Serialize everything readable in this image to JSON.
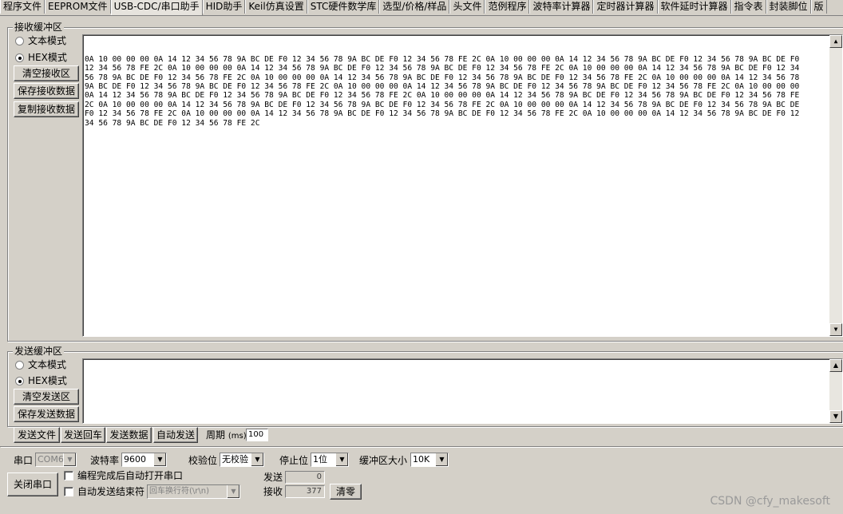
{
  "tabs": [
    "程序文件",
    "EEPROM文件",
    "USB-CDC/串口助手",
    "HID助手",
    "Keil仿真设置",
    "STC硬件数学库",
    "选型/价格/样品",
    "头文件",
    "范例程序",
    "波特率计算器",
    "定时器计算器",
    "软件延时计算器",
    "指令表",
    "封装脚位",
    "版"
  ],
  "receive": {
    "title": "接收缓冲区",
    "mode_text": "文本模式",
    "mode_hex": "HEX模式",
    "clear_btn": "清空接收区",
    "save_btn": "保存接收数据",
    "copy_btn": "复制接收数据",
    "lines": [
      "0A 10 00 00 00 0A 14 12 34 56 78 9A BC DE F0 12 34 56 78 9A BC DE F0 12 34 56 78 FE 2C 0A 10 00 00 00 0A 14 12 34 56 78 9A BC DE F0 12 34 56 78 9A BC DE F0",
      "12 34 56 78 FE 2C 0A 10 00 00 00 0A 14 12 34 56 78 9A BC DE F0 12 34 56 78 9A BC DE F0 12 34 56 78 FE 2C 0A 10 00 00 00 0A 14 12 34 56 78 9A BC DE F0 12 34",
      "56 78 9A BC DE F0 12 34 56 78 FE 2C 0A 10 00 00 00 0A 14 12 34 56 78 9A BC DE F0 12 34 56 78 9A BC DE F0 12 34 56 78 FE 2C 0A 10 00 00 00 0A 14 12 34 56 78",
      "9A BC DE F0 12 34 56 78 9A BC DE F0 12 34 56 78 FE 2C 0A 10 00 00 00 0A 14 12 34 56 78 9A BC DE F0 12 34 56 78 9A BC DE F0 12 34 56 78 FE 2C 0A 10 00 00 00",
      "0A 14 12 34 56 78 9A BC DE F0 12 34 56 78 9A BC DE F0 12 34 56 78 FE 2C 0A 10 00 00 00 0A 14 12 34 56 78 9A BC DE F0 12 34 56 78 9A BC DE F0 12 34 56 78 FE",
      "2C 0A 10 00 00 00 0A 14 12 34 56 78 9A BC DE F0 12 34 56 78 9A BC DE F0 12 34 56 78 FE 2C 0A 10 00 00 00 0A 14 12 34 56 78 9A BC DE F0 12 34 56 78 9A BC DE",
      "F0 12 34 56 78 FE 2C 0A 10 00 00 00 0A 14 12 34 56 78 9A BC DE F0 12 34 56 78 9A BC DE F0 12 34 56 78 FE 2C 0A 10 00 00 00 0A 14 12 34 56 78 9A BC DE F0 12",
      "34 56 78 9A BC DE F0 12 34 56 78 FE 2C"
    ]
  },
  "send": {
    "title": "发送缓冲区",
    "mode_text": "文本模式",
    "mode_hex": "HEX模式",
    "clear_btn": "清空发送区",
    "save_btn": "保存发送数据",
    "content": ""
  },
  "send_bar": {
    "send_file": "发送文件",
    "send_enter": "发送回车",
    "send_data": "发送数据",
    "auto_send": "自动发送",
    "period_label": "周期",
    "period_unit": "(ms)",
    "period_value": "100"
  },
  "settings": {
    "port_label": "串口",
    "port_value": "COM6",
    "baud_label": "波特率",
    "baud_value": "9600",
    "parity_label": "校验位",
    "parity_value": "无校验",
    "stop_label": "停止位",
    "stop_value": "1位",
    "buffer_label": "缓冲区大小",
    "buffer_value": "10K",
    "close_port_btn": "关闭串口",
    "auto_open_label": "编程完成后自动打开串口",
    "auto_end_label": "自动发送结束符",
    "end_char_value": "回车换行符(\\r\\n)",
    "sent_label": "发送",
    "sent_value": "0",
    "recv_label": "接收",
    "recv_value": "377",
    "reset_btn": "清零"
  },
  "watermark": "CSDN @cfy_makesoft"
}
